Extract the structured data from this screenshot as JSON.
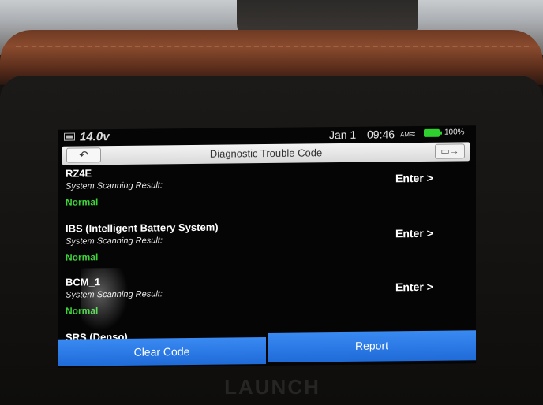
{
  "status_bar": {
    "voltage": "14.0v",
    "date": "Jan 1",
    "time": "09:46",
    "time_suffix": "AM",
    "battery": "100%",
    "battery_color": "#2fd12f"
  },
  "header": {
    "title": "Diagnostic Trouble Code",
    "back_icon": "back-arrow-icon",
    "exit_icon": "exit-icon"
  },
  "systems": [
    {
      "name": "RZ4E",
      "label": "System Scanning Result:",
      "status": "Normal",
      "action": "Enter >"
    },
    {
      "name": "IBS (Intelligent Battery System)",
      "label": "System Scanning Result:",
      "status": "Normal",
      "action": "Enter >"
    },
    {
      "name": "BCM_1",
      "label": "System Scanning Result:",
      "status": "Normal",
      "action": "Enter >"
    }
  ],
  "partial_item": "SRS (Denso)",
  "footer": {
    "clear_label": "Clear Code",
    "report_label": "Report",
    "button_color": "#2a7be6"
  },
  "device_brand": "LAUNCH"
}
